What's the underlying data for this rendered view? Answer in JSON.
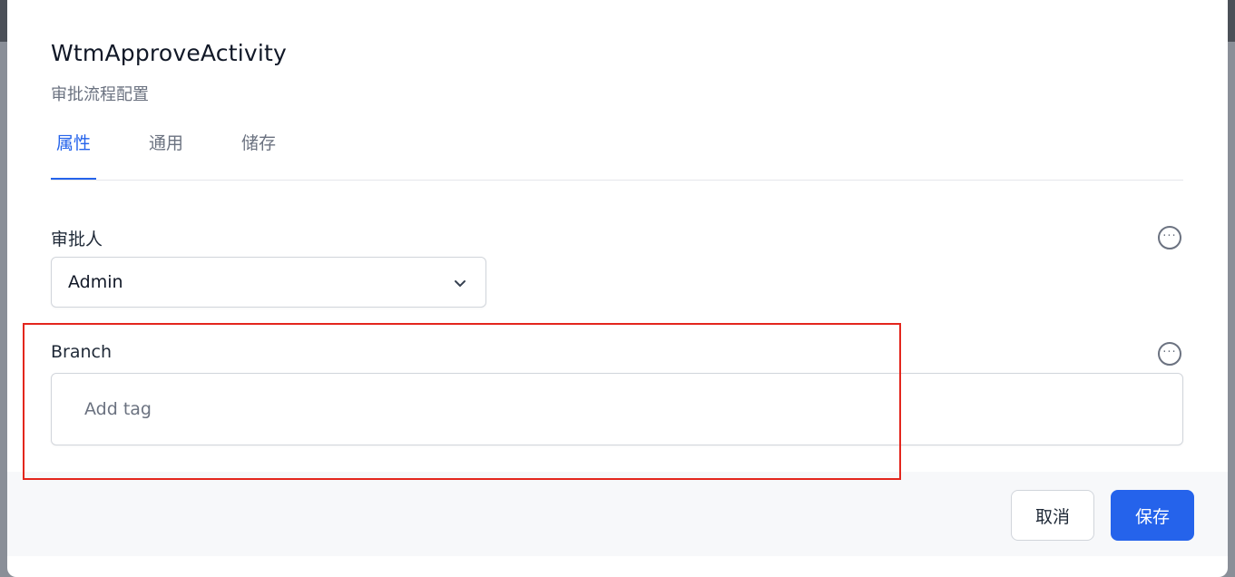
{
  "dialog": {
    "title": "WtmApproveActivity",
    "subtitle": "审批流程配置"
  },
  "tabs": [
    {
      "label": "属性",
      "active": true
    },
    {
      "label": "通用",
      "active": false
    },
    {
      "label": "储存",
      "active": false
    }
  ],
  "fields": {
    "approver": {
      "label": "审批人",
      "value": "Admin"
    },
    "branch": {
      "label": "Branch",
      "placeholder": "Add tag"
    }
  },
  "footer": {
    "cancel_label": "取消",
    "save_label": "保存"
  },
  "icons": {
    "more": "more-horizontal-circle-icon",
    "chevron": "chevron-down-icon"
  },
  "colors": {
    "accent": "#2563eb",
    "highlight": "#e3261d"
  }
}
